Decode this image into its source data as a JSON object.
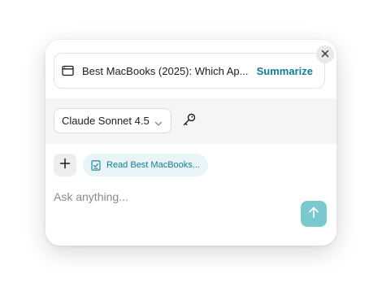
{
  "page_context": {
    "title": "Best MacBooks (2025): Which Ap...",
    "summarize_label": "Summarize"
  },
  "model_selector": {
    "selected": "Claude Sonnet 4.5"
  },
  "context_chip": {
    "label": "Read Best MacBooks..."
  },
  "composer": {
    "placeholder": "Ask anything..."
  },
  "icons": {
    "close": "close-icon",
    "page": "browser-window-icon",
    "chevron": "chevron-down-icon",
    "key": "key-icon",
    "add": "plus-icon",
    "chip": "document-check-icon",
    "send": "arrow-up-icon"
  },
  "colors": {
    "accent": "#167b96",
    "send_button": "#79c9cf",
    "chip_background": "#e9f4f7"
  }
}
